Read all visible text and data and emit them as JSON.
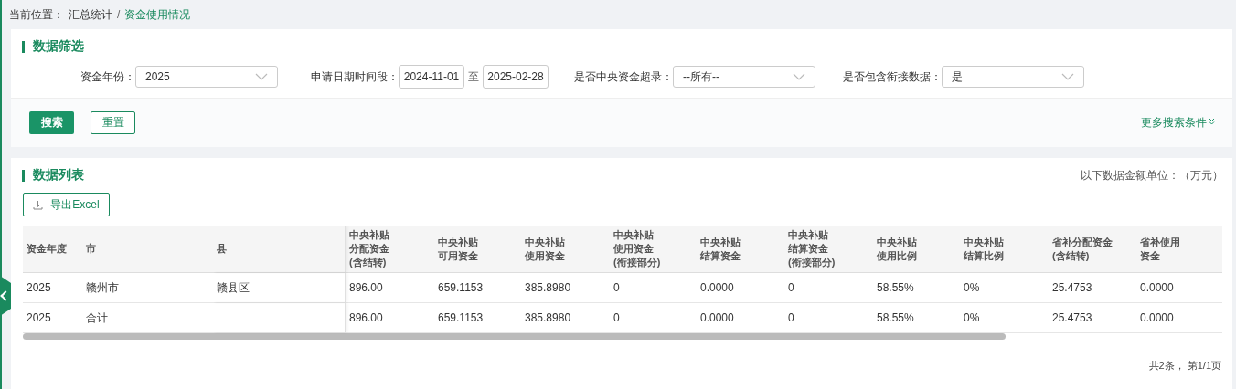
{
  "breadcrumb": {
    "label": "当前位置：",
    "items": [
      {
        "text": "汇总统计",
        "current": false
      },
      {
        "text": "资金使用情况",
        "current": true
      }
    ],
    "separator": "/"
  },
  "filter": {
    "title": "数据筛选",
    "fields": [
      {
        "kind": "select",
        "label": "资金年份：",
        "value": "2025"
      },
      {
        "kind": "daterange",
        "label": "申请日期时间段：",
        "from": "2024-11-01",
        "sep": "至",
        "to": "2025-02-28"
      },
      {
        "kind": "select",
        "label": "是否中央资金超录：",
        "value": "--所有--"
      },
      {
        "kind": "select",
        "label": "是否包含衔接数据：",
        "value": "是"
      }
    ],
    "buttons": [
      {
        "label": "搜索",
        "primary": true
      },
      {
        "label": "重置",
        "primary": false
      }
    ],
    "more": "更多搜索条件"
  },
  "list": {
    "title": "数据列表",
    "unit_note": "以下数据金额单位：（万元）",
    "export": "导出Excel",
    "columns": [
      "资金年度",
      "市",
      "县",
      "中央补贴分配资金(含结转)",
      "中央补贴可用资金",
      "中央补贴使用资金",
      "中央补贴使用资金(衔接部分)",
      "中央补贴结算资金",
      "中央补贴结算资金(衔接部分)",
      "中央补贴使用比例",
      "中央补贴结算比例",
      "省补分配资金(含结转)",
      "省补使用资金"
    ],
    "rows": [
      [
        "2025",
        "赣州市",
        "赣县区",
        "896.00",
        "659.1153",
        "385.8980",
        "0",
        "0.0000",
        "0",
        "58.55%",
        "0%",
        "25.4753",
        "0.0000"
      ],
      [
        "2025",
        "合计",
        "",
        "896.00",
        "659.1153",
        "385.8980",
        "0",
        "0.0000",
        "0",
        "58.55%",
        "0%",
        "25.4753",
        "0.0000"
      ]
    ],
    "pagination": "共2条， 第1/1页"
  }
}
